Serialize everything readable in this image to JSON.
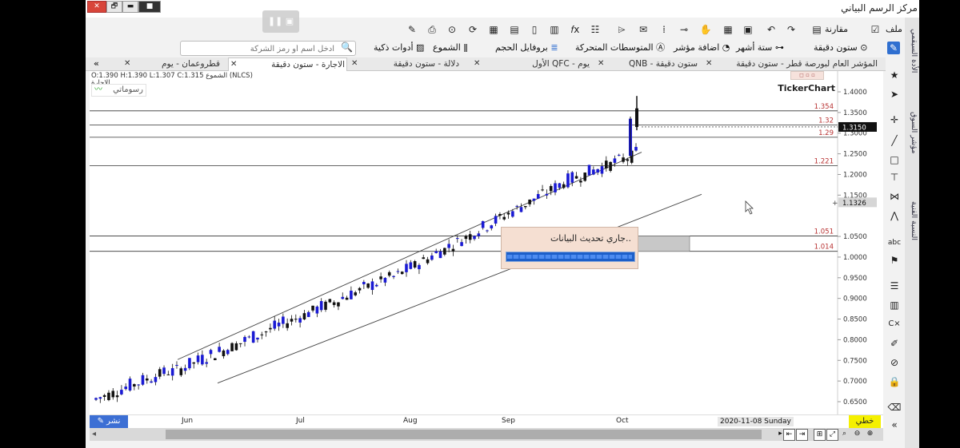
{
  "window": {
    "title": "مركز الرسم البياني",
    "controls": {
      "close": "✕",
      "maximize": "🗗",
      "minimize": "▬",
      "record": "■"
    }
  },
  "toolbar_row1": {
    "file": "ملف",
    "compare": "مقارنة"
  },
  "toolbar_row2": {
    "interval": "ستون دقيقة",
    "period": "ستة أشهر",
    "add_indicator": "اضافة مؤشر",
    "moving_averages": "المتوسطات المتحركة",
    "volume_profile": "بروفايل الحجم",
    "candles": "الشموع",
    "smart_tools": "أدوات ذكية",
    "search_placeholder": "ادخل اسم أو رمز الشركة"
  },
  "tabs": [
    {
      "label": "المؤشر العام لبورصة قطر - ستون دقيقة",
      "active": false
    },
    {
      "label": "QNB - ستون دقيقة",
      "active": false
    },
    {
      "label": "الأول QFC - يوم",
      "active": false
    },
    {
      "label": "دلالة - ستون دقيقة",
      "active": false
    },
    {
      "label": "الاجارة - ستون دقيقة",
      "active": true
    },
    {
      "label": "قطروعمان - يوم",
      "active": false
    }
  ],
  "tabs_more": "«",
  "chart_header": {
    "ohlc": "O:1.390  H:1.390  L:1.307  C:1.315",
    "symbol": "الشموع (NLCS)",
    "symbol_name": "الاجارة",
    "drawings_label": "رسوماتي",
    "brand": "TickerChart"
  },
  "chart_data": {
    "type": "candlestick",
    "x_labels": [
      "Jun",
      "Jul",
      "Aug",
      "Sep",
      "Oct"
    ],
    "y_ticks": [
      "1.4000",
      "1.3500",
      "1.3000",
      "1.2500",
      "1.2000",
      "1.1500",
      "1.0500",
      "1.0000",
      "0.9500",
      "0.9000",
      "0.8500",
      "0.8000",
      "0.7500",
      "0.7000",
      "0.6500"
    ],
    "ylim": [
      0.63,
      1.41
    ],
    "current_price": "1.3150",
    "cursor_price": "1.1326",
    "levels": [
      {
        "value": 1.354,
        "label": "1.354"
      },
      {
        "value": 1.32,
        "label": "1.32"
      },
      {
        "value": 1.29,
        "label": "1.29"
      },
      {
        "value": 1.221,
        "label": "1.221"
      },
      {
        "value": 1.051,
        "label": "1.051"
      },
      {
        "value": 1.014,
        "label": "1.014"
      }
    ],
    "channel": "ascending",
    "colors": {
      "up": "#1a1ad4",
      "down": "#111111",
      "levels": "#b83232",
      "box": "#c8c8c8"
    }
  },
  "bottom": {
    "share": "نشر",
    "date": "2020-11-08 Sunday",
    "lines": "خطي"
  },
  "loading_dialog": {
    "message": "جاري تحديث البيانات..",
    "progress": 0.99
  },
  "side_panel": {
    "tabs": [
      "الأدة السيقمي",
      "مؤشر السوق",
      "النسبة الفنية"
    ]
  }
}
